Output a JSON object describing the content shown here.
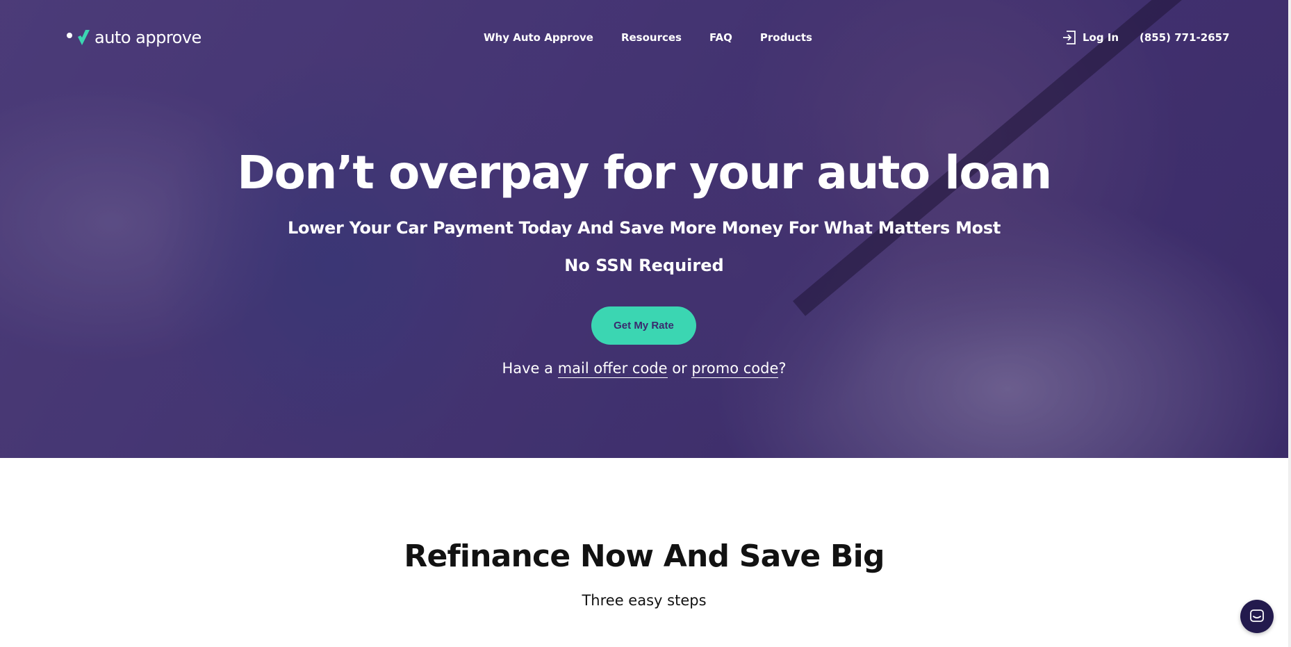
{
  "brand": {
    "name": "auto approve",
    "accent": "#3bd6b2",
    "primary": "#3a2a6e"
  },
  "nav": {
    "links": [
      {
        "label": "Why Auto Approve"
      },
      {
        "label": "Resources"
      },
      {
        "label": "FAQ"
      },
      {
        "label": "Products"
      }
    ],
    "login_label": "Log In",
    "phone": "(855) 771-2657"
  },
  "hero": {
    "headline": "Don’t overpay for your auto loan",
    "subhead": "Lower Your Car Payment Today And Save More Money For What Matters Most",
    "no_ssn": "No SSN Required",
    "cta_label": "Get My Rate",
    "promo_prefix": "Have a",
    "promo_link1": "mail offer code",
    "promo_or": "or",
    "promo_link2": "promo code",
    "promo_suffix": "?"
  },
  "section": {
    "title": "Refinance Now And Save Big",
    "subtitle": "Three easy steps"
  },
  "icons": {
    "login": "login-arrow-icon",
    "chat": "chat-bubble-icon",
    "logo": "checkmark-logo-icon"
  }
}
